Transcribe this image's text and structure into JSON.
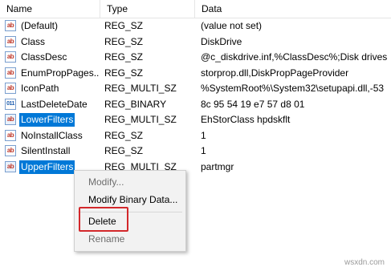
{
  "header": {
    "name": "Name",
    "type": "Type",
    "data": "Data"
  },
  "rows": [
    {
      "name": "(Default)",
      "type": "REG_SZ",
      "data": "(value not set)",
      "icon": "string-value-icon"
    },
    {
      "name": "Class",
      "type": "REG_SZ",
      "data": "DiskDrive",
      "icon": "string-value-icon"
    },
    {
      "name": "ClassDesc",
      "type": "REG_SZ",
      "data": "@c_diskdrive.inf,%ClassDesc%;Disk drives",
      "icon": "string-value-icon"
    },
    {
      "name": "EnumPropPages...",
      "type": "REG_SZ",
      "data": "storprop.dll,DiskPropPageProvider",
      "icon": "string-value-icon"
    },
    {
      "name": "IconPath",
      "type": "REG_MULTI_SZ",
      "data": "%SystemRoot%\\System32\\setupapi.dll,-53",
      "icon": "string-value-icon"
    },
    {
      "name": "LastDeleteDate",
      "type": "REG_BINARY",
      "data": "8c 95 54 19 e7 57 d8 01",
      "icon": "binary-value-icon"
    },
    {
      "name": "LowerFilters",
      "type": "REG_MULTI_SZ",
      "data": "EhStorClass hpdskflt",
      "icon": "string-value-icon",
      "selected": true
    },
    {
      "name": "NoInstallClass",
      "type": "REG_SZ",
      "data": "1",
      "icon": "string-value-icon"
    },
    {
      "name": "SilentInstall",
      "type": "REG_SZ",
      "data": "1",
      "icon": "string-value-icon"
    },
    {
      "name": "UpperFilters",
      "type": "REG_MULTI_SZ",
      "data": "partmgr",
      "icon": "string-value-icon",
      "selected": true
    }
  ],
  "context_menu": {
    "modify": "Modify...",
    "modify_binary": "Modify Binary Data...",
    "delete": "Delete",
    "rename": "Rename"
  },
  "watermark": "wsxdn.com",
  "colors": {
    "selection": "#0078d7",
    "highlight_box": "#d3282b",
    "menu_background": "#f2f2f2"
  }
}
